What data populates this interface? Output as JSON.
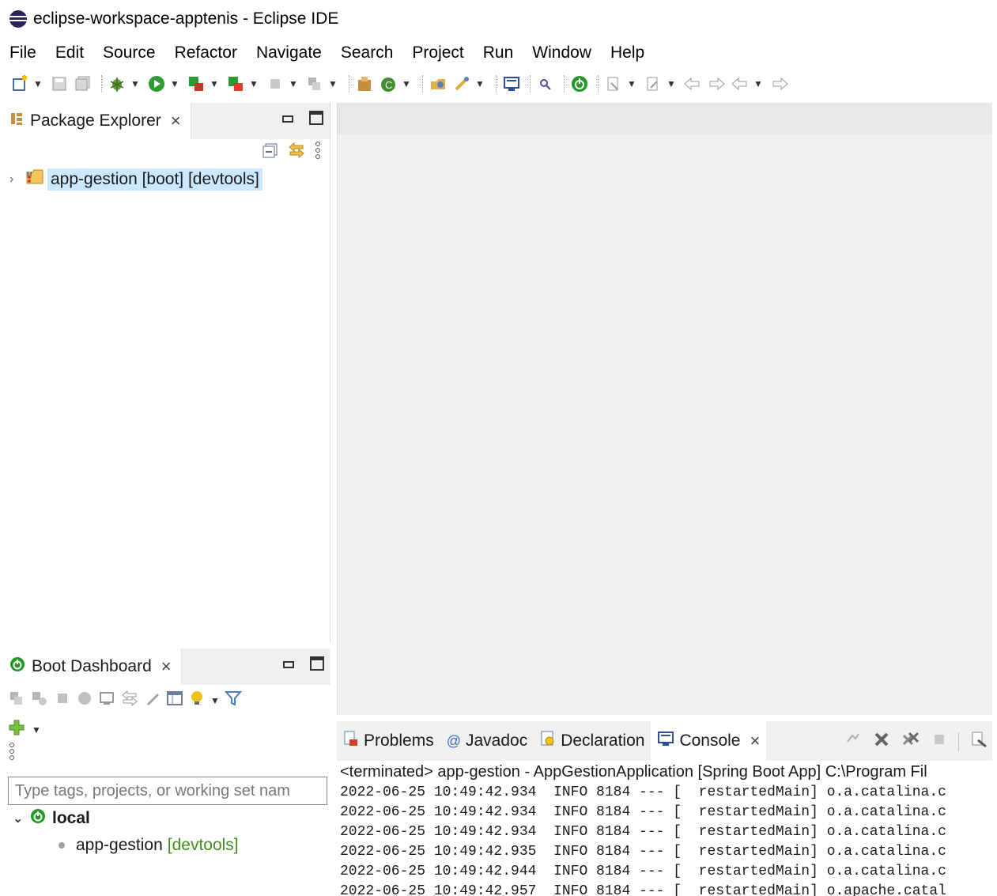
{
  "window": {
    "title": "eclipse-workspace-apptenis - Eclipse IDE"
  },
  "menu": {
    "items": [
      "File",
      "Edit",
      "Source",
      "Refactor",
      "Navigate",
      "Search",
      "Project",
      "Run",
      "Window",
      "Help"
    ]
  },
  "toolbar": {
    "icons": [
      "new-wizard-icon",
      "save-icon",
      "save-all-icon",
      "debug-icon",
      "run-icon",
      "run-coverage-icon",
      "external-tools-icon",
      "stop-icon",
      "boot-relaunch-icon",
      "new-package-icon",
      "new-class-icon",
      "open-type-icon",
      "search-icon",
      "console-icon",
      "spring-icon",
      "next-annotation-icon",
      "previous-annotation-icon",
      "back-icon",
      "forward-icon"
    ]
  },
  "package_explorer": {
    "tab_label": "Package Explorer",
    "project_label": "app-gestion [boot] [devtools]"
  },
  "boot_dashboard": {
    "tab_label": "Boot Dashboard",
    "search_placeholder": "Type tags, projects, or working set nam",
    "local_label": "local",
    "app_name": "app-gestion",
    "app_tag": "[devtools]"
  },
  "bottom_tabs": {
    "problems": "Problems",
    "javadoc": "Javadoc",
    "declaration": "Declaration",
    "console": "Console"
  },
  "console": {
    "status": "<terminated> app-gestion - AppGestionApplication [Spring Boot App] C:\\Program Fil",
    "lines": [
      "2022-06-25 10:49:42.934  INFO 8184 --- [  restartedMain] o.a.catalina.c",
      "2022-06-25 10:49:42.934  INFO 8184 --- [  restartedMain] o.a.catalina.c",
      "2022-06-25 10:49:42.934  INFO 8184 --- [  restartedMain] o.a.catalina.c",
      "2022-06-25 10:49:42.935  INFO 8184 --- [  restartedMain] o.a.catalina.c",
      "2022-06-25 10:49:42.944  INFO 8184 --- [  restartedMain] o.a.catalina.c",
      "2022-06-25 10:49:42.957  INFO 8184 --- [  restartedMain] o.apache.catal"
    ]
  }
}
